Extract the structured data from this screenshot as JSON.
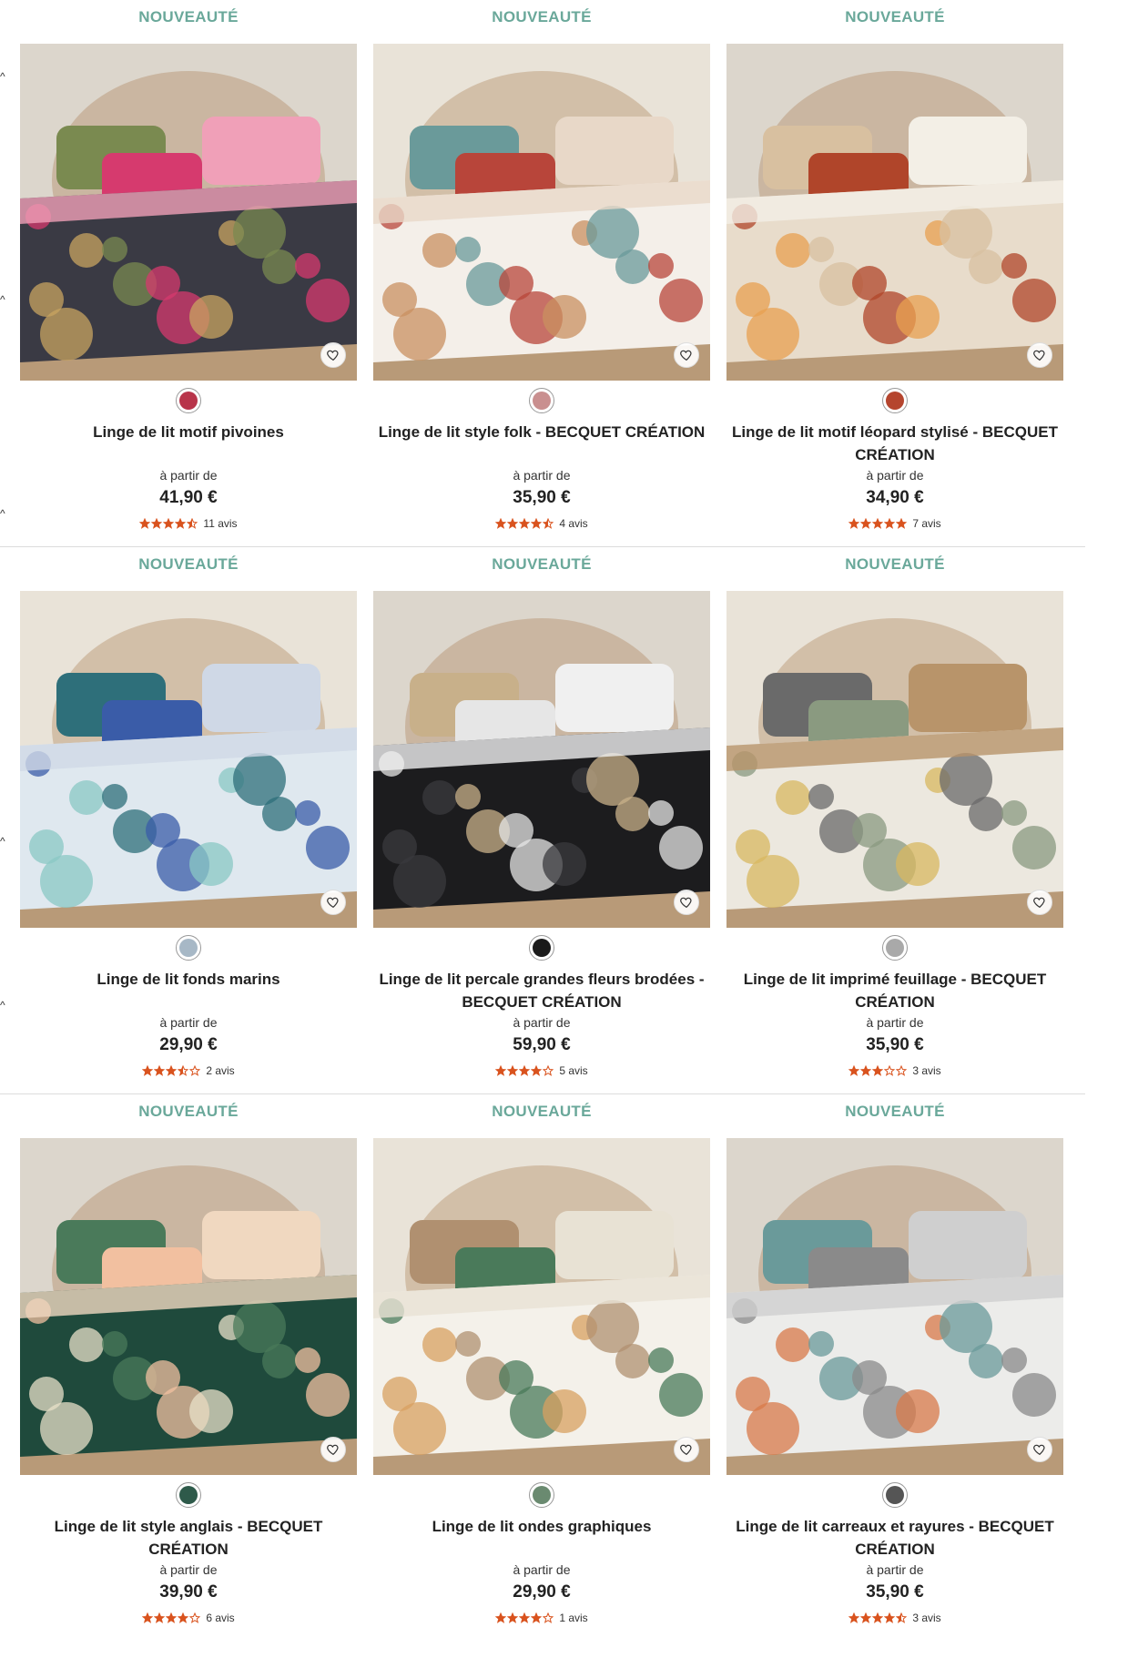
{
  "badge_label": "NOUVEAUTÉ",
  "from_label": "à partir de",
  "star_color": "#d9531e",
  "badge_color": "#6aa89a",
  "products": [
    {
      "name": "Linge de lit motif pivoines",
      "price": "41,90 €",
      "rating": 4.5,
      "reviews": "11 avis",
      "swatch": "#b8344a",
      "palette": [
        "#3a3a44",
        "#d63a6e",
        "#c8a460",
        "#7a8a50",
        "#f0a0b8"
      ],
      "favorite_icon": "heart-icon"
    },
    {
      "name": "Linge de lit style folk - BECQUET CRÉATION",
      "price": "35,90 €",
      "rating": 4.5,
      "reviews": "4 avis",
      "swatch": "#c98f8f",
      "palette": [
        "#f4efe9",
        "#b8453a",
        "#c99060",
        "#6a9a9a",
        "#e8d8c8"
      ],
      "favorite_icon": "heart-icon"
    },
    {
      "name": "Linge de lit motif léopard stylisé - BECQUET CRÉATION",
      "price": "34,90 €",
      "rating": 5,
      "reviews": "7 avis",
      "swatch": "#b5452e",
      "palette": [
        "#e8dccb",
        "#b0452a",
        "#e8a050",
        "#d8c0a0",
        "#f3efe6"
      ],
      "favorite_icon": "heart-icon"
    },
    {
      "name": "Linge de lit fonds marins",
      "price": "29,90 €",
      "rating": 3.5,
      "reviews": "2 avis",
      "swatch": "#a7b8c6",
      "palette": [
        "#dfe8ef",
        "#3a5ca8",
        "#8ac8c4",
        "#2e6f7a",
        "#cfd8e6"
      ],
      "favorite_icon": "heart-icon"
    },
    {
      "name": "Linge de lit percale grandes fleurs brodées - BECQUET CRÉATION",
      "price": "59,90 €",
      "rating": 4,
      "reviews": "5 avis",
      "swatch": "#1a1a1a",
      "palette": [
        "#1c1c1e",
        "#e6e6e6",
        "#3a3a3e",
        "#c8b08a",
        "#f0f0f0"
      ],
      "favorite_icon": "heart-icon"
    },
    {
      "name": "Linge de lit imprimé feuillage - BECQUET CRÉATION",
      "price": "35,90 €",
      "rating": 3,
      "reviews": "3 avis",
      "swatch": "#a9a9a9",
      "palette": [
        "#ece8df",
        "#8a9a80",
        "#d8b860",
        "#6a6a6a",
        "#b8946a"
      ],
      "favorite_icon": "heart-icon"
    },
    {
      "name": "Linge de lit style anglais - BECQUET CRÉATION",
      "price": "39,90 €",
      "rating": 4,
      "reviews": "6 avis",
      "swatch": "#2e5a4a",
      "palette": [
        "#1f4a3c",
        "#f2c0a0",
        "#e8e0c8",
        "#4a7a5a",
        "#f0d8c0"
      ],
      "favorite_icon": "heart-icon"
    },
    {
      "name": "Linge de lit ondes graphiques",
      "price": "29,90 €",
      "rating": 4,
      "reviews": "1 avis",
      "swatch": "#6a8a70",
      "palette": [
        "#f4f1ea",
        "#4a7a5a",
        "#d8a060",
        "#b09070",
        "#e8e2d4"
      ],
      "favorite_icon": "heart-icon"
    },
    {
      "name": "Linge de lit carreaux et rayures - BECQUET CRÉATION",
      "price": "35,90 €",
      "rating": 4.5,
      "reviews": "3 avis",
      "swatch": "#555555",
      "palette": [
        "#ececea",
        "#8a8a8a",
        "#d87a4a",
        "#6a9a9a",
        "#cfcfcf"
      ],
      "favorite_icon": "heart-icon"
    }
  ]
}
